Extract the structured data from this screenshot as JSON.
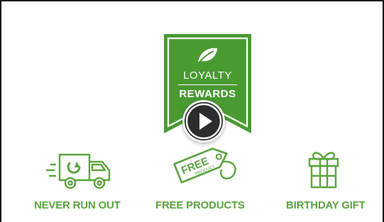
{
  "badge": {
    "line1": "LOYALTY",
    "line2": "REWARDS",
    "icon": "leaf-icon",
    "color": "#4a9a32"
  },
  "video": {
    "play_icon": "play-icon"
  },
  "features": [
    {
      "icon": "delivery-truck-icon",
      "label": "NEVER RUN OUT"
    },
    {
      "icon": "price-tag-icon",
      "label": "FREE PRODUCTS",
      "tag_line1": "FREE",
      "tag_line2": "PRODUCT"
    },
    {
      "icon": "gift-box-icon",
      "label": "BIRTHDAY GIFT"
    }
  ],
  "colors": {
    "accent": "#5aa43d",
    "badge": "#4a9a32",
    "frame": "#1a1a1a"
  }
}
